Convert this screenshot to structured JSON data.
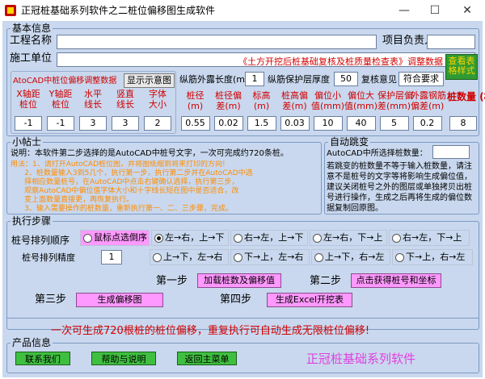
{
  "window": {
    "title": "正冠桩基础系列软件之二桩位偏移图生成软件",
    "minimize": "—",
    "maximize": "☐",
    "close": "✕"
  },
  "basic": {
    "legend": "基本信息",
    "project_label": "工程名称",
    "project_value": "",
    "manager_label": "项目负责人",
    "manager_value": "",
    "constructor_label": "施工单位",
    "constructor_value": "",
    "notice": "《土方开挖后桩基础复核及桩质量检查表》调整数据",
    "green_btn": "查看表格样式",
    "autocad_title": "AtoCAD中桩位偏移调整数据",
    "show_btn": "显示示意图",
    "rebar_len_label": "纵筋外露长度(m)",
    "rebar_len_value": "1",
    "cover_label": "纵筋保护层厚度",
    "cover_value": "50",
    "opinion_label": "复核意见",
    "opinion_value": "符合要求",
    "left_cols": [
      {
        "label": "X轴距\n桩位",
        "value": "-1"
      },
      {
        "label": "Y轴距\n桩位",
        "value": "-1"
      },
      {
        "label": "水平\n线长",
        "value": "3"
      },
      {
        "label": "竖直\n线长",
        "value": "3"
      },
      {
        "label": "字体\n大小",
        "value": "2"
      }
    ],
    "right_cols": [
      {
        "label": "桩径\n(m)",
        "value": "0.55"
      },
      {
        "label": "桩径偏\n差(m)",
        "value": "0.02"
      },
      {
        "label": "标高\n(m)",
        "value": "1.5"
      },
      {
        "label": "桩高偏\n差(m)",
        "value": "0.03"
      },
      {
        "label": "偏位小\n值(mm)",
        "value": "10"
      },
      {
        "label": "偏位大\n值(mm)",
        "value": "40"
      },
      {
        "label": "保护层偏\n差(mm)",
        "value": "5"
      },
      {
        "label": "外露钢筋\n偏差(m)",
        "value": "0.2"
      }
    ],
    "pile_count_label": "桩数量\n(根)",
    "pile_count_value": "8"
  },
  "tips": {
    "legend": "小帖士",
    "line1": "说明：本软件第二步选择的是AutoCAD中桩号文字，一次可完成约720条桩。",
    "usage": "用法：1、请打开AutoCAD桩位图，并将图纸缩到将来打印的方向!\n      2、桩数量输入3到5几个，执行第一步，执行第二步并在AutoCAD中选\n      择相应数量桩号，在AutoCAD中点击右键确认选择，执行第三步，\n      观察AutoCAD中偏位值字体大小和十字线长短在图中是否适合，改\n      变上面数量直接更，再恢复执行。\n      3、输入需要操作的桩数量，重新执行第一、二、三步骤，完成。"
  },
  "autojump": {
    "legend": "自动跳变",
    "label": "AutoCAD中所选择桩数量：",
    "value": "",
    "desc": "若跳变的桩数量不等于输入桩数量，请注意不是桩号的文字等将影响生成偏位值，建议关闭桩号之外的图层或单独拷贝出桩号进行操作，生成之后再将生成的偏位数据复制回原图。"
  },
  "steps": {
    "legend": "执行步骤",
    "order_label": "桩号排列顺序",
    "precision_label": "桩号排列精度",
    "precision_value": "1",
    "radios_row1": [
      {
        "label": "鼠标点选倒序",
        "on": false
      },
      {
        "label": "左→右，上→下",
        "on": true
      },
      {
        "label": "右→左，上→下",
        "on": false
      },
      {
        "label": "左→右，下→上",
        "on": false
      },
      {
        "label": "右→左，下→上",
        "on": false
      }
    ],
    "radios_row2": [
      {
        "label": "上→下，左→右",
        "on": false
      },
      {
        "label": "下→上，左→右",
        "on": false
      },
      {
        "label": "上→下，右→左",
        "on": false
      },
      {
        "label": "下→上，右→左",
        "on": false
      }
    ],
    "step1_label": "第一步",
    "step1_btn": "加载桩数及偏移值",
    "step2_label": "第二步",
    "step2_btn": "点击获得桩号和坐标",
    "step3_label": "第三步",
    "step3_btn": "生成偏移图",
    "step4_label": "第四步",
    "step4_btn": "生成Excel开挖表",
    "slogan": "一次可生成720根桩的桩位偏移，重复执行可自动生成无限桩位偏移!"
  },
  "product": {
    "legend": "产品信息",
    "contact_btn": "联系我们",
    "help_btn": "帮助与说明",
    "back_btn": "返回主菜单",
    "brand": "正冠桩基础系列软件"
  },
  "colors": {
    "client_bg": "#c9d8ee",
    "accent_red": "#d10000",
    "pink": "#ff99ff",
    "green": "#2e9b32",
    "brand": "#e040e0",
    "tips_orange": "#ff8c00"
  }
}
